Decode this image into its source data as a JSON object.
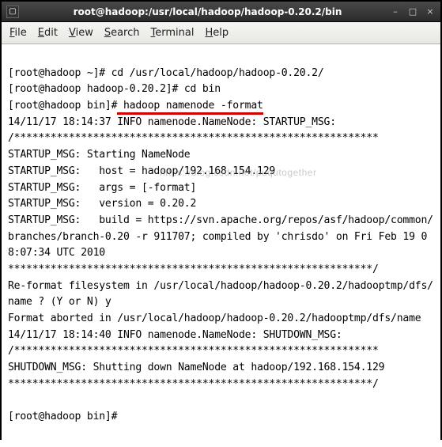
{
  "titlebar": {
    "title": "root@hadoop:/usr/local/hadoop/hadoop-0.20.2/bin"
  },
  "menu": {
    "file": "File",
    "edit": "Edit",
    "view": "View",
    "search": "Search",
    "terminal": "Terminal",
    "help": "Help"
  },
  "terminal": {
    "line1_prompt": "[root@hadoop ~]# ",
    "line1_cmd": "cd /usr/local/hadoop/hadoop-0.20.2/",
    "line2_prompt": "[root@hadoop hadoop-0.20.2]# ",
    "line2_cmd": "cd bin",
    "line3_prompt": "[root@hadoop bin]#",
    "line3_cmd": " hadoop namenode -format",
    "line4": "14/11/17 18:14:37 INFO namenode.NameNode: STARTUP_MSG:",
    "line5": "/************************************************************",
    "line6": "STARTUP_MSG: Starting NameNode",
    "line7": "STARTUP_MSG:   host = hadoop/192.168.154.129",
    "line8": "STARTUP_MSG:   args = [-format]",
    "line9": "STARTUP_MSG:   version = 0.20.2",
    "line10": "STARTUP_MSG:   build = https://svn.apache.org/repos/asf/hadoop/common/branches/branch-0.20 -r 911707; compiled by 'chrisdo' on Fri Feb 19 08:07:34 UTC 2010",
    "line11": "************************************************************/",
    "line12": "Re-format filesystem in /usr/local/hadoop/hadoop-0.20.2/hadooptmp/dfs/name ? (Y or N) y",
    "line13": "Format aborted in /usr/local/hadoop/hadoop-0.20.2/hadooptmp/dfs/name",
    "line14": "14/11/17 18:14:40 INFO namenode.NameNode: SHUTDOWN_MSG:",
    "line15": "/************************************************************",
    "line16": "SHUTDOWN_MSG: Shutting down NameNode at hadoop/192.168.154.129",
    "line17": "************************************************************/",
    "line18_prompt": "[root@hadoop bin]#"
  },
  "watermark": "https://blog.csdn.net/puqutogether"
}
